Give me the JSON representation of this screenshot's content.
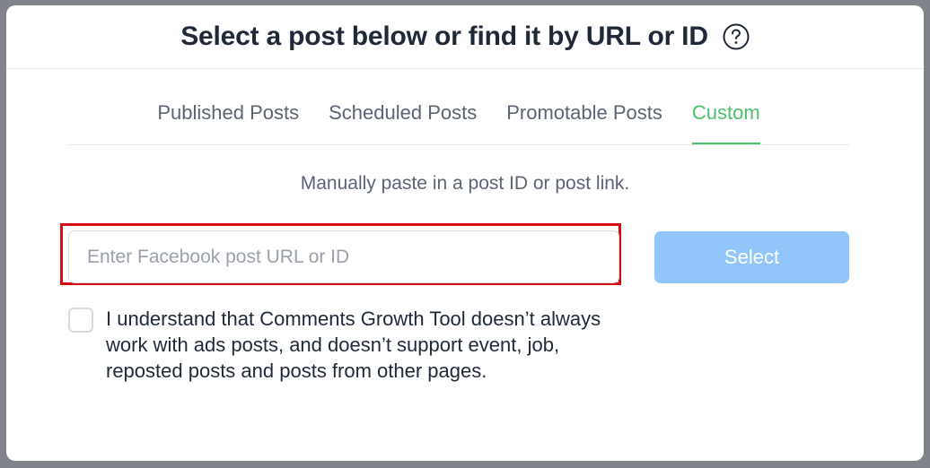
{
  "modal": {
    "title": "Select a post below or find it by URL or ID",
    "help_icon": "question-circle-icon"
  },
  "tabs": [
    {
      "label": "Published Posts",
      "active": false
    },
    {
      "label": "Scheduled Posts",
      "active": false
    },
    {
      "label": "Promotable Posts",
      "active": false
    },
    {
      "label": "Custom",
      "active": true
    }
  ],
  "custom": {
    "hint": "Manually paste in a post ID or post link.",
    "input_placeholder": "Enter Facebook post URL or ID",
    "input_value": "",
    "select_label": "Select",
    "consent_text": "I understand that Comments Growth Tool doesn’t always work with ads posts, and doesn’t support event, job, reposted posts and posts from other pages.",
    "consent_checked": false
  },
  "colors": {
    "accent_green": "#4cc16b",
    "button_disabled_blue": "#92c6fb",
    "highlight_red": "#d50d12"
  }
}
